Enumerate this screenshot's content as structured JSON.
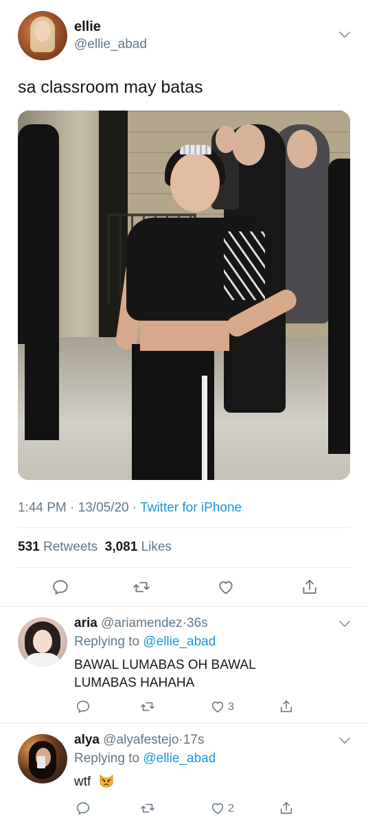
{
  "tweet": {
    "author_name": "ellie",
    "author_handle": "@ellie_abad",
    "text": "sa classroom may batas",
    "time": "1:44 PM",
    "date": "13/05/20",
    "separator": "·",
    "source": "Twitter for iPhone",
    "retweets_count": "531",
    "retweets_label": "Retweets",
    "likes_count": "3,081",
    "likes_label": "Likes",
    "media_icon": "photo",
    "actions": [
      "reply-icon",
      "retweet-icon",
      "like-icon",
      "share-icon"
    ]
  },
  "replies": [
    {
      "name": "aria",
      "handle": "@ariamendez",
      "age": "36s",
      "replying_label": "Replying to",
      "replying_to": "@ellie_abad",
      "text_line1": "BAWAL LUMABAS OH BAWAL",
      "text_line2": "LUMABAS HAHAHA",
      "like_count": "3"
    },
    {
      "name": "alya",
      "handle": "@alyafestejo",
      "age": "17s",
      "replying_label": "Replying to",
      "replying_to": "@ellie_abad",
      "text": "wtf",
      "emoji": "pouting-cat-emoji",
      "like_count": "2"
    }
  ],
  "colors": {
    "text": "#14171a",
    "secondary": "#657786",
    "link": "#1b95e0",
    "divider": "#e6ecf0"
  }
}
